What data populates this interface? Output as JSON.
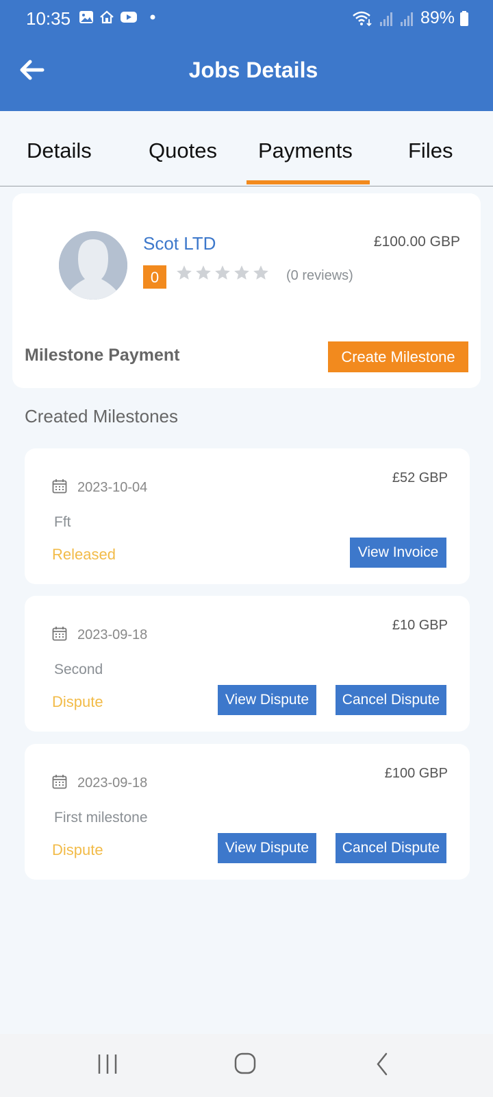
{
  "status_bar": {
    "time": "10:35",
    "battery": "89%"
  },
  "header": {
    "title": "Jobs Details"
  },
  "tabs": [
    {
      "label": "Details"
    },
    {
      "label": "Quotes"
    },
    {
      "label": "Payments"
    },
    {
      "label": "Files"
    }
  ],
  "profile": {
    "company": "Scot LTD",
    "price": "£100.00 GBP",
    "rating": "0",
    "reviews": "(0 reviews)",
    "milestone_label": "Milestone Payment",
    "create_button": "Create Milestone"
  },
  "section_title": "Created Milestones",
  "milestones": [
    {
      "date": "2023-10-04",
      "amount": "£52 GBP",
      "description": "Fft",
      "status": "Released",
      "button1": "View Invoice"
    },
    {
      "date": "2023-09-18",
      "amount": "£10 GBP",
      "description": "Second",
      "status": "Dispute",
      "button1": "View Dispute",
      "button2": "Cancel Dispute"
    },
    {
      "date": "2023-09-18",
      "amount": "£100 GBP",
      "description": "First milestone",
      "status": "Dispute",
      "button1": "View Dispute",
      "button2": "Cancel Dispute"
    }
  ],
  "colors": {
    "primary": "#3d78cb",
    "accent": "#f28a1e",
    "status": "#f2bb48",
    "background": "#f3f7fb"
  }
}
